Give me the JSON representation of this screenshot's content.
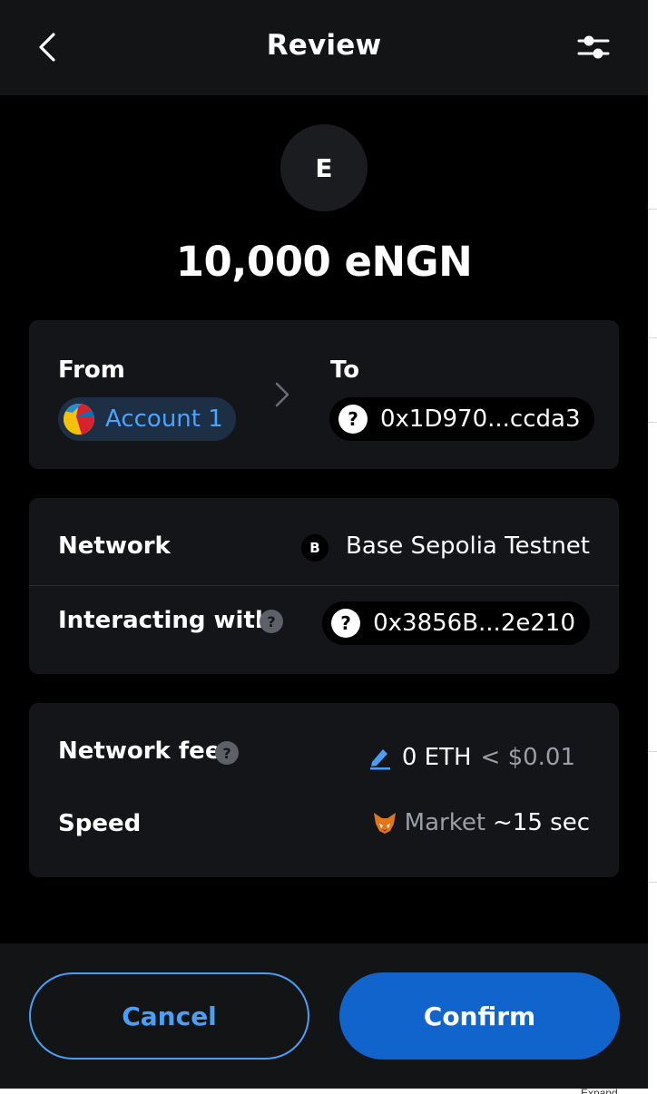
{
  "header": {
    "title": "Review"
  },
  "token": {
    "avatar_letter": "E",
    "amount": "10,000 eNGN"
  },
  "transfer": {
    "from_label": "From",
    "to_label": "To",
    "from_account": "Account 1",
    "to_address": "0x1D970...ccda3"
  },
  "details": {
    "network_label": "Network",
    "network_icon_letter": "B",
    "network_value": "Base Sepolia Testnet",
    "interacting_label": "Interacting with",
    "interacting_address": "0x3856B...2e210"
  },
  "fee": {
    "network_fee_label": "Network fee",
    "fee_eth": "0 ETH",
    "fee_fiat": "< $0.01",
    "speed_label": "Speed",
    "speed_market": "Market",
    "speed_time": "~15 sec"
  },
  "footer": {
    "cancel_label": "Cancel",
    "confirm_label": "Confirm"
  },
  "bottom_peek_text": "Expand",
  "colors": {
    "accent": "#4a9ff5",
    "confirm": "#1064cc",
    "card": "#141518",
    "header": "#131416"
  }
}
